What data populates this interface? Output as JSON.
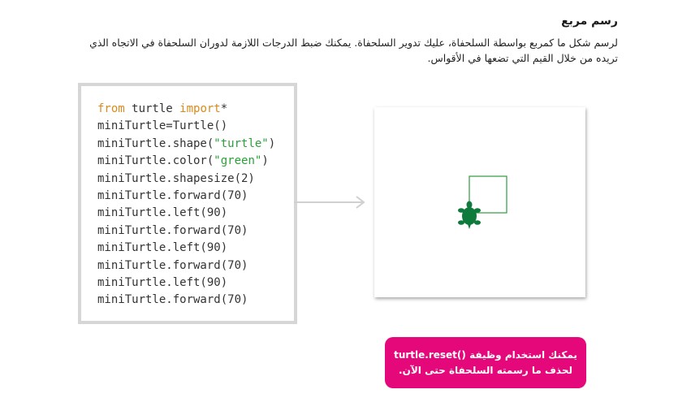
{
  "heading": "رسم مربع",
  "paragraph": "لرسم شكل ما كمربع بواسطة السلحفاة، عليك تدوير السلحفاة. يمكنك ضبط الدرجات اللازمة لدوران السلحفاة في الاتجاه الذي تريده من خلال القيم التي تضعها في الأقواس.",
  "code": {
    "line1_kw1": "from",
    "line1_mid": " turtle ",
    "line1_kw2": "import",
    "line1_end": "*",
    "line2": "miniTurtle=Turtle()",
    "line3_pre": "miniTurtle.shape(",
    "line3_str": "\"turtle\"",
    "line3_post": ")",
    "line4_pre": "miniTurtle.color(",
    "line4_str": "\"green\"",
    "line4_post": ")",
    "line5": "miniTurtle.shapesize(2)",
    "line6": "miniTurtle.forward(70)",
    "line7": "miniTurtle.left(90)",
    "line8": "miniTurtle.forward(70)",
    "line9": "miniTurtle.left(90)",
    "line10": "miniTurtle.forward(70)",
    "line11": "miniTurtle.left(90)",
    "line12": "miniTurtle.forward(70)"
  },
  "colors": {
    "keyword": "#d98a1e",
    "string": "#2aa03a",
    "turtle": "#0e7a3c",
    "square_line": "#2e9a3e",
    "note_background": "#e4087a"
  },
  "icons": {
    "arrow": "right-arrow-icon",
    "turtle": "turtle-icon"
  },
  "note": {
    "line1": "يمكنك استخدام وظيفة ()turtle.reset",
    "line2": "لحذف ما رسمته السلحفاة حتى الآن."
  }
}
